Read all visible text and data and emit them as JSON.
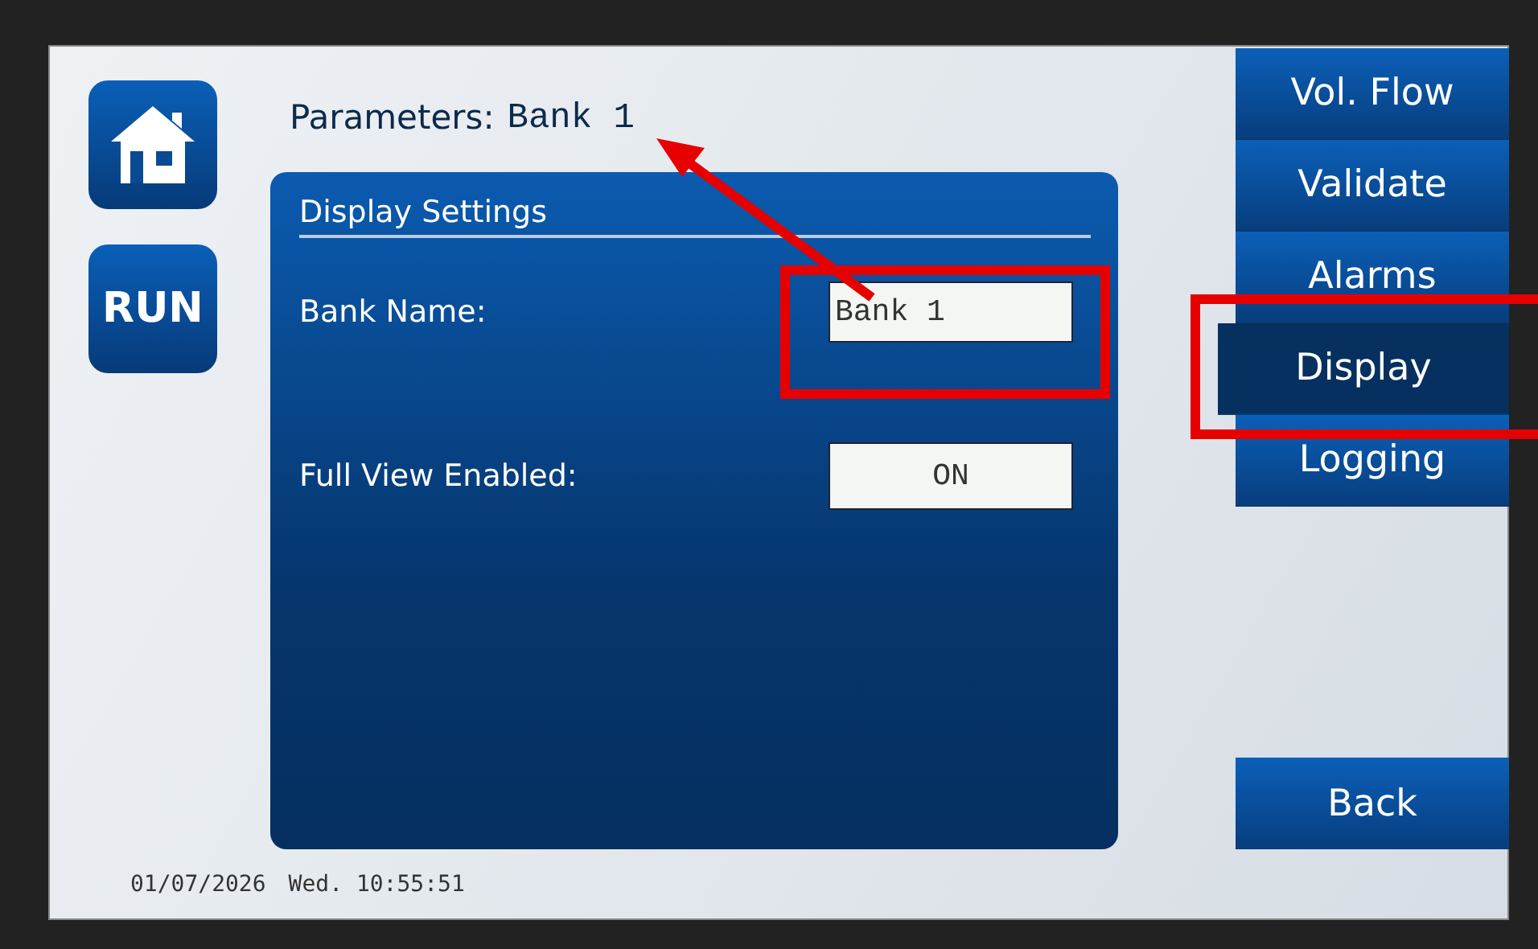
{
  "header": {
    "label": "Parameters:",
    "value": "Bank 1"
  },
  "side_buttons": [
    {
      "kind": "home"
    },
    {
      "kind": "run",
      "label": "RUN"
    }
  ],
  "panel": {
    "title": "Display Settings",
    "settings": [
      {
        "label": "Bank Name:",
        "kind": "text",
        "value": "Bank 1"
      },
      {
        "label": "Full View Enabled:",
        "kind": "toggle",
        "value": "ON"
      }
    ]
  },
  "nav": [
    {
      "label": "Vol. Flow",
      "selected": false
    },
    {
      "label": "Validate",
      "selected": false
    },
    {
      "label": "Alarms",
      "selected": false
    },
    {
      "label": "Display",
      "selected": true
    },
    {
      "label": "Logging",
      "selected": false
    }
  ],
  "back_button": "Back",
  "status_bar": {
    "date": "01/07/2026",
    "day_time": "Wed. 10:55:51"
  },
  "annotations": [
    {
      "kind": "frame"
    },
    {
      "kind": "frame"
    },
    {
      "kind": "arrow"
    }
  ]
}
